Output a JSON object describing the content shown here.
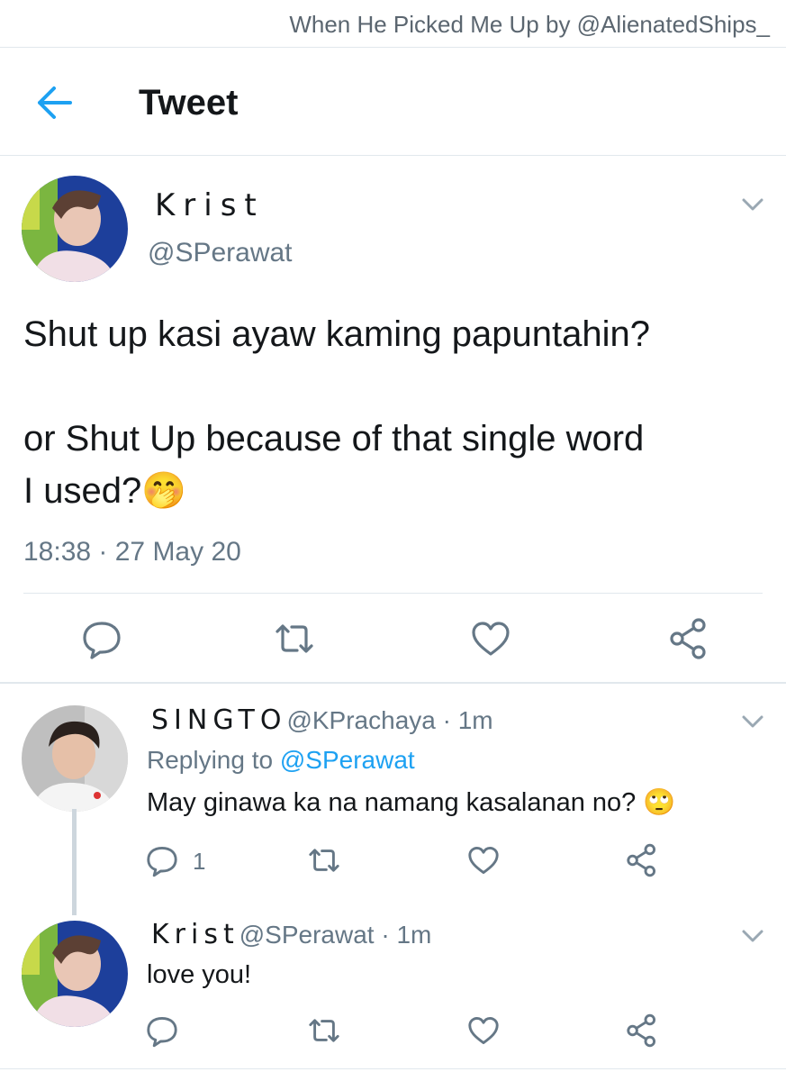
{
  "watermark": "When He Picked Me Up by @AlienatedShips_",
  "header": {
    "title": "Tweet"
  },
  "main_tweet": {
    "name": "Krist",
    "handle": "@SPerawat",
    "text": "Shut up kasi ayaw kaming papuntahin?\n\nor Shut Up because of that single word\nI used?",
    "emoji": "🤭",
    "timestamp": "18:38 · 27 May 20"
  },
  "replies": [
    {
      "name": "SINGTO",
      "handle": "@KPrachaya",
      "time": " · 1m",
      "replying_label": "Replying to ",
      "replying_handle": "@SPerawat",
      "text": "May ginawa ka na namang kasalanan no? 🙄",
      "reply_count": "1"
    },
    {
      "name": "Krist",
      "handle": "@SPerawat",
      "time": " · 1m",
      "text": "love you!"
    }
  ],
  "colors": {
    "accent": "#1da1f2",
    "muted": "#657786",
    "divider": "#e1e8ed"
  },
  "icons": [
    "back-arrow-icon",
    "chevron-down-icon",
    "reply-icon",
    "retweet-icon",
    "like-icon",
    "share-icon"
  ]
}
